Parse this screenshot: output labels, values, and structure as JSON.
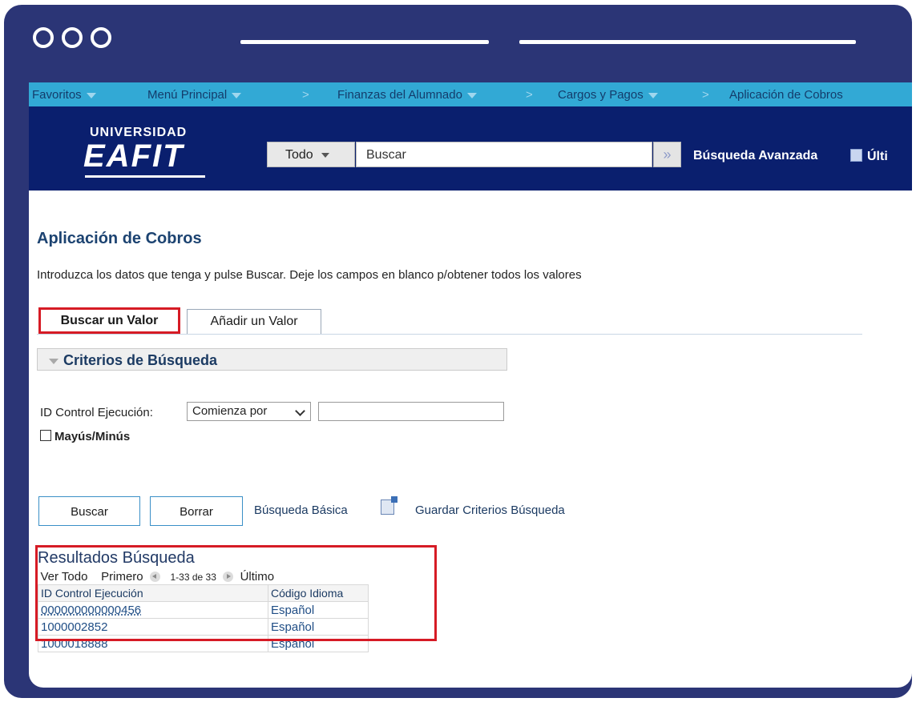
{
  "nav": {
    "items": [
      "Favoritos",
      "Menú Principal",
      "Finanzas del Alumnado",
      "Cargos y Pagos",
      "Aplicación de Cobros"
    ],
    "separator": ">"
  },
  "header": {
    "logo_top": "UNIVERSIDAD",
    "logo_main": "EAFIT",
    "search_scope": "Todo",
    "search_placeholder": "Buscar",
    "advanced_search": "Búsqueda Avanzada",
    "last_link": "Últi"
  },
  "page": {
    "title": "Aplicación de Cobros",
    "instructions": "Introduzca los datos que tenga y pulse Buscar. Deje los campos en blanco p/obtener todos los valores"
  },
  "tabs": [
    "Buscar un Valor",
    "Añadir un Valor"
  ],
  "criteria": {
    "title": "Criterios de Búsqueda",
    "field_label": "ID Control Ejecución:",
    "operator": "Comienza por",
    "value": "",
    "case_label": "Mayús/Minús"
  },
  "buttons": {
    "search": "Buscar",
    "clear": "Borrar",
    "basic_search": "Búsqueda Básica",
    "save_criteria": "Guardar Criterios Búsqueda"
  },
  "results": {
    "title": "Resultados Búsqueda",
    "view_all": "Ver Todo",
    "first": "Primero",
    "range": "1-33 de 33",
    "last": "Último",
    "columns": [
      "ID Control Ejecución",
      "Código Idioma"
    ],
    "rows": [
      [
        "000000000000456",
        "Español"
      ],
      [
        "1000002852",
        "Español"
      ],
      [
        "1000018888",
        "Español"
      ]
    ]
  },
  "colors": {
    "frame": "#2b3576",
    "nav_bar": "#32a9d5",
    "header_bg": "#0a1f6e",
    "highlight": "#d61b25"
  }
}
